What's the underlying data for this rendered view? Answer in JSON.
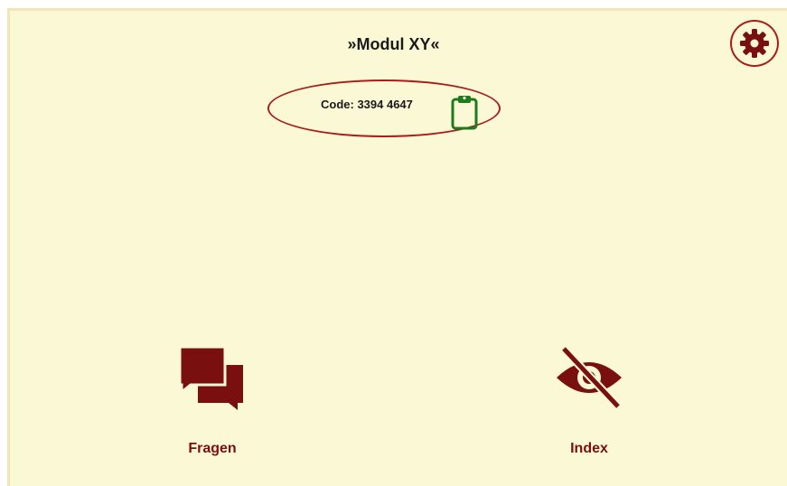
{
  "header": {
    "title": "»Modul XY«"
  },
  "code": {
    "text": "Code: 3394 4647"
  },
  "icons": {
    "settings": "gear-icon",
    "copy": "clipboard-icon",
    "fragen": "chat-bubbles-icon",
    "index": "eye-slash-icon"
  },
  "tiles": [
    {
      "label": "Fragen"
    },
    {
      "label": "Index"
    }
  ],
  "colors": {
    "background": "#fbf9d5",
    "accent": "#7a0f0f",
    "highlight_ring": "#a91d1d",
    "clipboard": "#1e7a1e"
  }
}
